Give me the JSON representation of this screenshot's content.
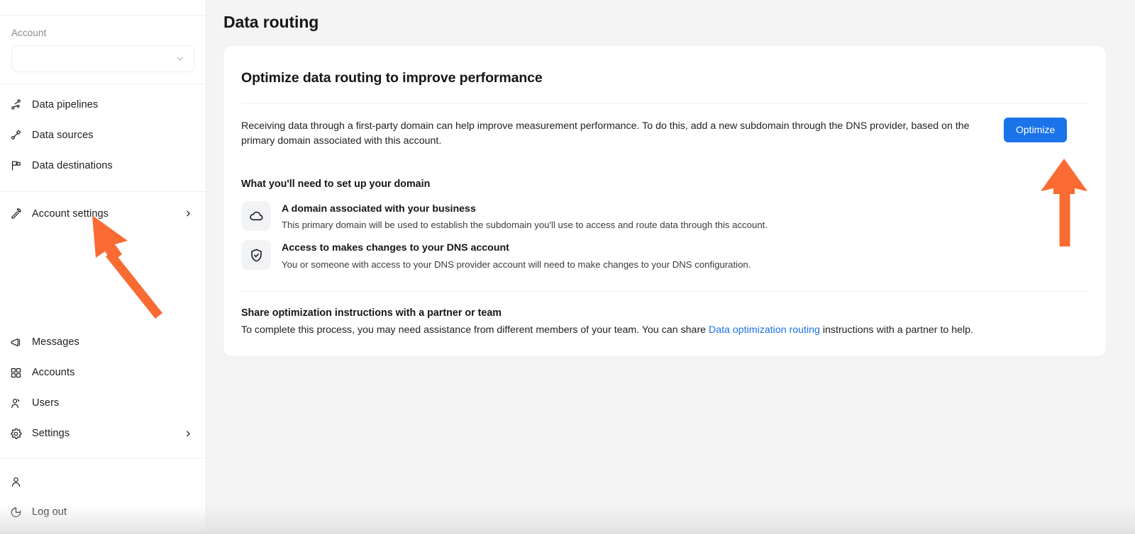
{
  "sidebar": {
    "account_label": "Account",
    "account_select": {
      "value": "",
      "placeholder": "",
      "chevron_icon": "chevron-down-icon"
    },
    "primary_items": [
      {
        "label": "Data pipelines",
        "icon": "data-pipelines-icon",
        "has_caret": false
      },
      {
        "label": "Data sources",
        "icon": "data-sources-icon",
        "has_caret": false
      },
      {
        "label": "Data destinations",
        "icon": "data-destinations-icon",
        "has_caret": false
      }
    ],
    "settings_items": [
      {
        "label": "Account settings",
        "icon": "account-settings-icon",
        "has_caret": true
      }
    ],
    "lower_items": [
      {
        "label": "Messages",
        "icon": "megaphone-icon",
        "has_caret": false
      },
      {
        "label": "Accounts",
        "icon": "grid-icon",
        "has_caret": false
      },
      {
        "label": "Users",
        "icon": "users-icon",
        "has_caret": false
      },
      {
        "label": "Settings",
        "icon": "gear-icon",
        "has_caret": true
      }
    ],
    "footer_items": [
      {
        "label": "",
        "icon": "person-icon",
        "has_caret": false
      },
      {
        "label": "Log out",
        "icon": "log-out-icon",
        "has_caret": false
      }
    ]
  },
  "main": {
    "page_title": "Data routing",
    "card": {
      "title": "Optimize data routing to improve performance",
      "intro_paragraph": "Receiving data through a first-party domain can help improve measurement performance. To do this, add a new subdomain through the DNS provider, based on the primary domain associated with this account.",
      "optimize_button": "Optimize",
      "needs_heading": "What you'll need to set up your domain",
      "needs": [
        {
          "icon": "cloud-icon",
          "title": "A domain associated with your business",
          "description": "This primary domain will be used to establish the subdomain you'll use to access and route data through this account."
        },
        {
          "icon": "shield-check-icon",
          "title": "Access to makes changes to your DNS account",
          "description": "You or someone with access to your DNS provider account will need to make changes to your DNS configuration."
        }
      ],
      "share_heading": "Share optimization instructions with a partner or team",
      "share_text_before": "To complete this process, you may need assistance from different members of your team. You can share ",
      "share_link_text": "Data optimization routing",
      "share_text_after": " instructions with a partner to help."
    }
  },
  "annotations": {
    "arrow_color": "#f96b33",
    "arrows": [
      {
        "name": "arrow-pointing-to-account-settings",
        "direction": "up-left"
      },
      {
        "name": "arrow-pointing-to-optimize-button",
        "direction": "up"
      }
    ]
  },
  "colors": {
    "accent_blue": "#1a73e8",
    "page_background": "#f4f4f4",
    "card_background": "#ffffff",
    "arrow_orange": "#f96b33",
    "text_primary": "#161616",
    "text_muted": "#8a8a8a"
  }
}
